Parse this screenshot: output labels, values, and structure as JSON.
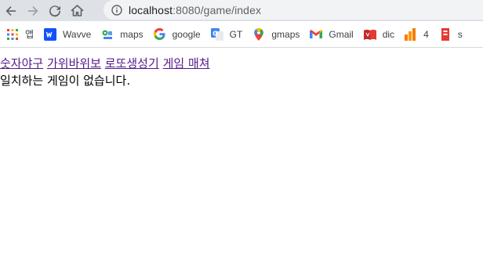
{
  "browser": {
    "url_host": "localhost",
    "url_rest": ":8080/game/index"
  },
  "bookmarks": [
    {
      "label": "앱",
      "icon": "apps-grid-icon"
    },
    {
      "label": "Wavve",
      "icon": "wavve-icon"
    },
    {
      "label": "maps",
      "icon": "maps-icon"
    },
    {
      "label": "google",
      "icon": "google-icon"
    },
    {
      "label": "GT",
      "icon": "google-translate-icon"
    },
    {
      "label": "gmaps",
      "icon": "google-maps-pin-icon"
    },
    {
      "label": "Gmail",
      "icon": "gmail-icon"
    },
    {
      "label": "dic",
      "icon": "dictionary-icon"
    },
    {
      "label": "4",
      "icon": "bars-icon"
    },
    {
      "label": "s",
      "icon": "red-bookmark-icon"
    }
  ],
  "page": {
    "links": [
      "숫자야구",
      "가위바위보",
      "로또생성기",
      "게임 매쳐"
    ],
    "message": "일치하는 게임이 없습니다."
  },
  "colors": {
    "toolbar_bg": "#dee1e6",
    "omnibox_bg": "#f1f3f4",
    "visited_link": "#551a8b"
  }
}
